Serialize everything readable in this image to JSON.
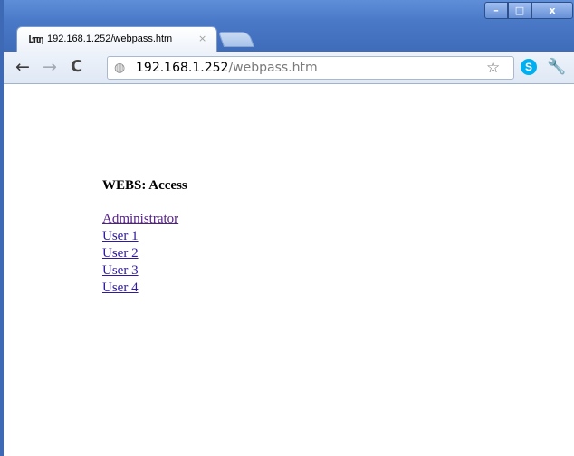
{
  "browser": {
    "tab": {
      "favicon": "Ŀπη",
      "title": "192.168.1.252/webpass.htm",
      "close_glyph": "×"
    },
    "window_controls": {
      "minimize": "–",
      "maximize": "□",
      "close": "x"
    },
    "toolbar": {
      "back_glyph": "←",
      "forward_glyph": "→",
      "reload_glyph": "C",
      "globe_glyph": "◍",
      "url_host": "192.168.1.252",
      "url_path": "/webpass.htm",
      "star_glyph": "☆",
      "skype_glyph": "S",
      "wrench_glyph": "🔧"
    }
  },
  "page": {
    "heading": "WEBS: Access",
    "links": [
      {
        "label": "Administrator"
      },
      {
        "label": "User 1"
      },
      {
        "label": "User 2"
      },
      {
        "label": "User 3"
      },
      {
        "label": "User 4"
      }
    ]
  },
  "colors": {
    "titlebar": "#4a79c8",
    "link": "#2d1aa0",
    "visited_link": "#551a8b"
  }
}
